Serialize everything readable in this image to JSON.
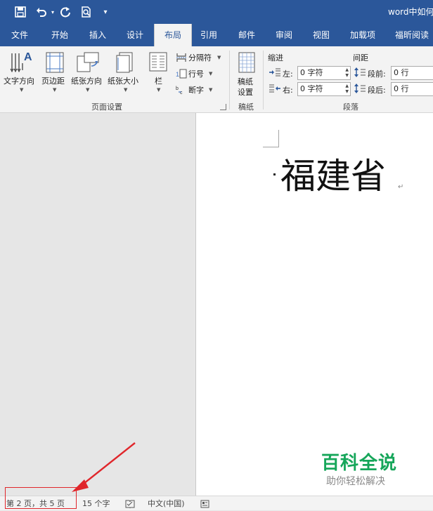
{
  "window": {
    "title": "word中如何"
  },
  "quick_access": [
    "save-icon",
    "undo-icon",
    "redo-icon",
    "print-preview-icon",
    "customize-dropdown-icon"
  ],
  "tabs": [
    {
      "label": "文件"
    },
    {
      "label": "开始"
    },
    {
      "label": "插入"
    },
    {
      "label": "设计"
    },
    {
      "label": "布局"
    },
    {
      "label": "引用"
    },
    {
      "label": "邮件"
    },
    {
      "label": "审阅"
    },
    {
      "label": "视图"
    },
    {
      "label": "加载项"
    },
    {
      "label": "福昕阅读"
    }
  ],
  "active_tab": "布局",
  "ribbon": {
    "page_setup": {
      "group_label": "页面设置",
      "text_direction": "文字方向",
      "margins": "页边距",
      "orientation": "纸张方向",
      "size": "纸张大小",
      "columns": "栏",
      "breaks": "分隔符",
      "line_numbers": "行号",
      "hyphenation": "断字"
    },
    "manuscript": {
      "group_label": "稿纸",
      "button_line1": "稿纸",
      "button_line2": "设置"
    },
    "paragraph": {
      "group_label": "段落",
      "indent_header": "缩进",
      "spacing_header": "间距",
      "left_label": "左:",
      "right_label": "右:",
      "before_label": "段前:",
      "after_label": "段后:",
      "left_value": "0 字符",
      "right_value": "0 字符",
      "before_value": "0 行",
      "after_value": "0 行"
    }
  },
  "document": {
    "heading_text": "福建省",
    "paragraph_mark": "↵"
  },
  "status": {
    "page_info": "第 2 页，共 5 页",
    "word_count": "15 个字",
    "language": "中文(中国)"
  },
  "watermark": {
    "title": "百科全说",
    "subtitle": "助你轻松解决"
  },
  "colors": {
    "ribbon_blue": "#2b579a",
    "annotation_red": "#e0262b",
    "watermark_green": "#16a65a"
  }
}
